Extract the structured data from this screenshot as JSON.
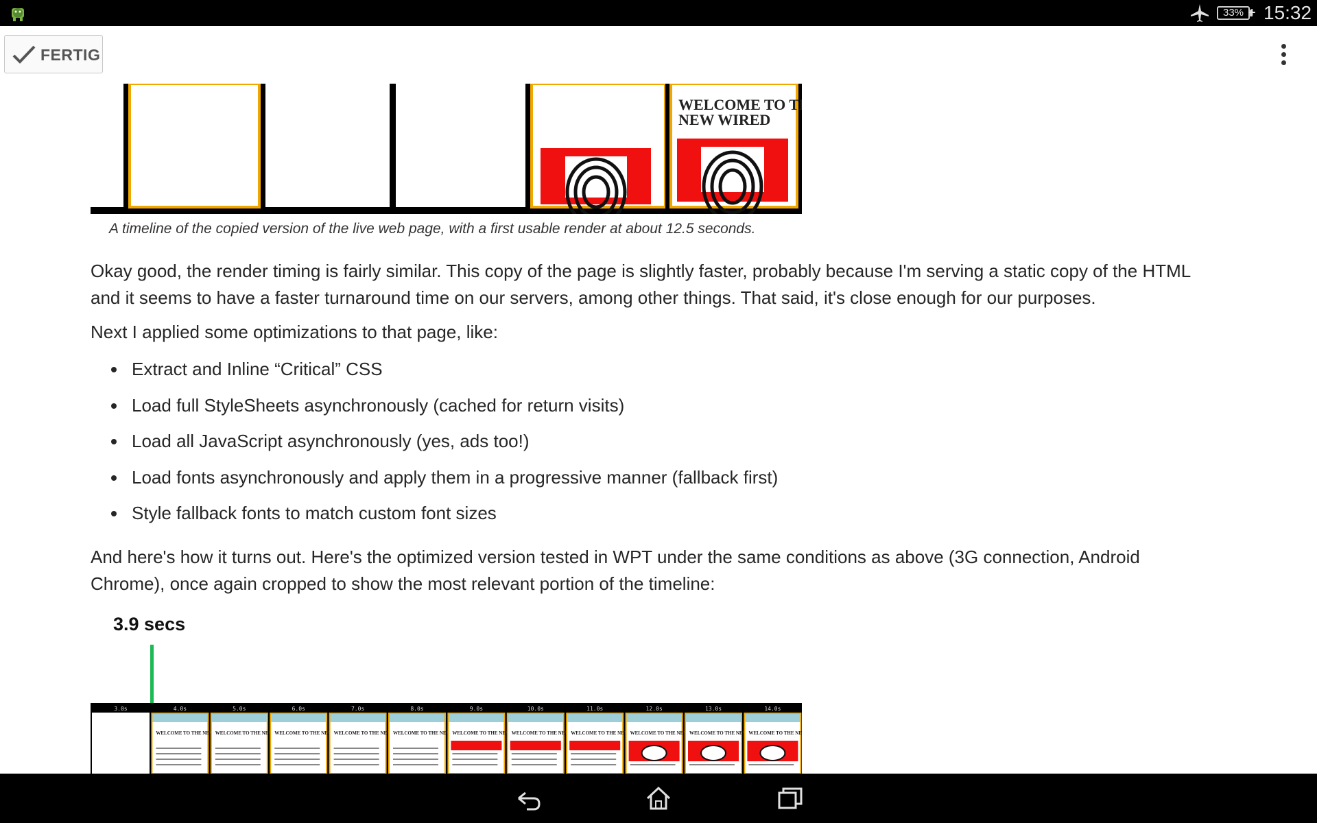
{
  "status_bar": {
    "time": "15:32",
    "battery": "33%",
    "icons": [
      "android-debug-icon",
      "airplane-mode-icon",
      "battery-icon",
      "charging-icon"
    ]
  },
  "action_bar": {
    "done_label": "FERTIG",
    "icons": [
      "checkmark-icon",
      "overflow-menu-icon"
    ]
  },
  "article": {
    "figure1_heading": "WELCOME TO THE NEW WIRED",
    "figure1_caption": "A timeline of the copied version of the live web page, with a first usable render at about 12.5 seconds.",
    "para1": "Okay good, the render timing is fairly similar. This copy of the page is slightly faster, probably because I'm serving a static copy of the HTML and it seems to have a faster turnaround time on our servers, among other things. That said, it's close enough for our purposes.",
    "para2": "Next I applied some optimizations to that page, like:",
    "bullets": [
      "Extract and Inline “Critical” CSS",
      "Load full StyleSheets asynchronously (cached for return visits)",
      "Load all JavaScript asynchronously (yes, ads too!)",
      "Load fonts asynchronously and apply them in a progressive manner (fallback first)",
      "Style fallback fonts to match custom font sizes"
    ],
    "para3": "And here's how it turns out. Here's the optimized version tested in WPT under the same conditions as above (3G connection, Android Chrome), once again cropped to show the most relevant portion of the timeline:",
    "figure2_marker": "3.9 secs",
    "figure2_frame_times": [
      "3.0s",
      "4.0s",
      "5.0s",
      "6.0s",
      "7.0s",
      "8.0s",
      "9.0s",
      "10.0s",
      "11.0s",
      "12.0s",
      "13.0s",
      "14.0s"
    ],
    "figure2_frame_heading": "WELCOME TO THE NEW WIRED"
  },
  "nav_bar": {
    "icons": [
      "back-icon",
      "home-icon",
      "recent-apps-icon"
    ]
  },
  "colors": {
    "frame_border": "#f0a800",
    "marker_green": "#1db954",
    "hero_red": "#f01010"
  }
}
